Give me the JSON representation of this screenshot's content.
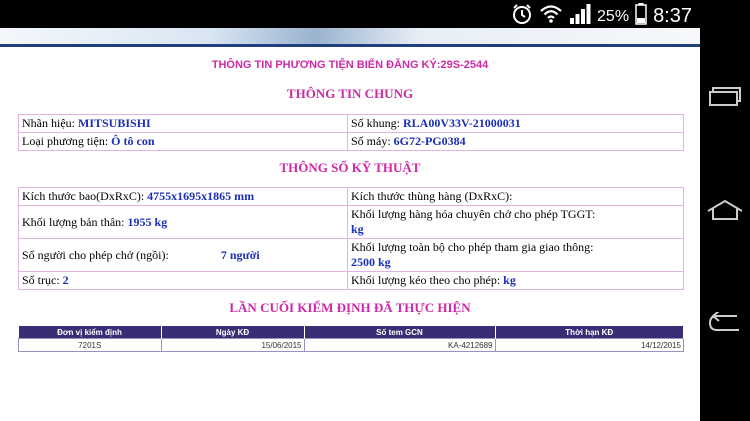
{
  "status_bar": {
    "battery": "25%",
    "time": "8:37"
  },
  "page_title": "THÔNG TIN PHƯƠNG TIỆN BIỂN ĐĂNG KÝ:29S-2544",
  "general": {
    "title": "THÔNG TIN CHUNG",
    "brand_label": "Nhãn hiệu:",
    "brand": "MITSUBISHI",
    "frame_label": "Số khung:",
    "frame": "RLA00V33V-21000031",
    "type_label": "Loại phương tiện:",
    "type": "Ô tô con",
    "engine_label": "Số máy:",
    "engine": "6G72-PG0384"
  },
  "specs": {
    "title": "THÔNG SỐ KỸ THUẬT",
    "dim_label": "Kích thước bao(DxRxC):",
    "dim": "4755x1695x1865 mm",
    "cargo_dim_label": "Kích thước thùng hàng (DxRxC):",
    "self_weight_label": "Khối lượng bản thân:",
    "self_weight": "1955 kg",
    "cargo_weight_label": "Khối lượng hàng hóa chuyên chở cho phép TGGT:",
    "cargo_weight": "kg",
    "seats_label": "Số người cho phép chở (ngồi):",
    "seats": "7 người",
    "total_weight_label": "Khối lượng toàn bộ cho phép tham gia giao thông:",
    "total_weight": "2500 kg",
    "axles_label": "Số trục:",
    "axles": "2",
    "tow_label": "Khối lượng kéo theo cho phép:",
    "tow": "kg"
  },
  "inspection": {
    "title": "LẦN CUỐI KIỂM ĐỊNH ĐÃ THỰC HIỆN",
    "headers": [
      "Đơn vị kiểm định",
      "Ngày KĐ",
      "Số tem GCN",
      "Thời hạn KĐ"
    ],
    "row": [
      "7201S",
      "15/06/2015",
      "KA-4212689",
      "14/12/2015"
    ]
  }
}
